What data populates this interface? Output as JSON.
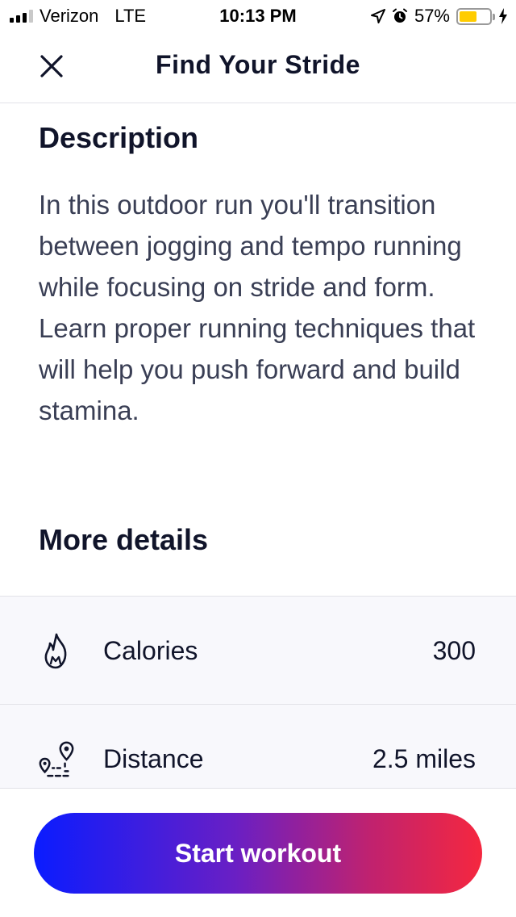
{
  "status_bar": {
    "carrier": "Verizon",
    "network": "LTE",
    "time": "10:13 PM",
    "battery": "57%",
    "battery_level": 0.57,
    "icons": [
      "signal-icon",
      "location-arrow-icon",
      "alarm-icon",
      "battery-icon",
      "charging-bolt-icon"
    ]
  },
  "header": {
    "title": "Find Your Stride",
    "close_icon": "close-icon"
  },
  "description": {
    "title": "Description",
    "text": "In this outdoor run you'll transition between jogging and tempo running while focusing on stride and form. Learn proper running techniques that will help you push forward and build stamina."
  },
  "more_details": {
    "title": "More details",
    "items": [
      {
        "icon": "flame-icon",
        "label": "Calories",
        "value": "300"
      },
      {
        "icon": "route-distance-icon",
        "label": "Distance",
        "value": "2.5 miles"
      }
    ]
  },
  "footer": {
    "start_label": "Start workout"
  },
  "colors": {
    "gradient_start": "#0a1cff",
    "gradient_end": "#f5273f",
    "text_dark": "#10142a",
    "battery": "#ffcc00"
  }
}
